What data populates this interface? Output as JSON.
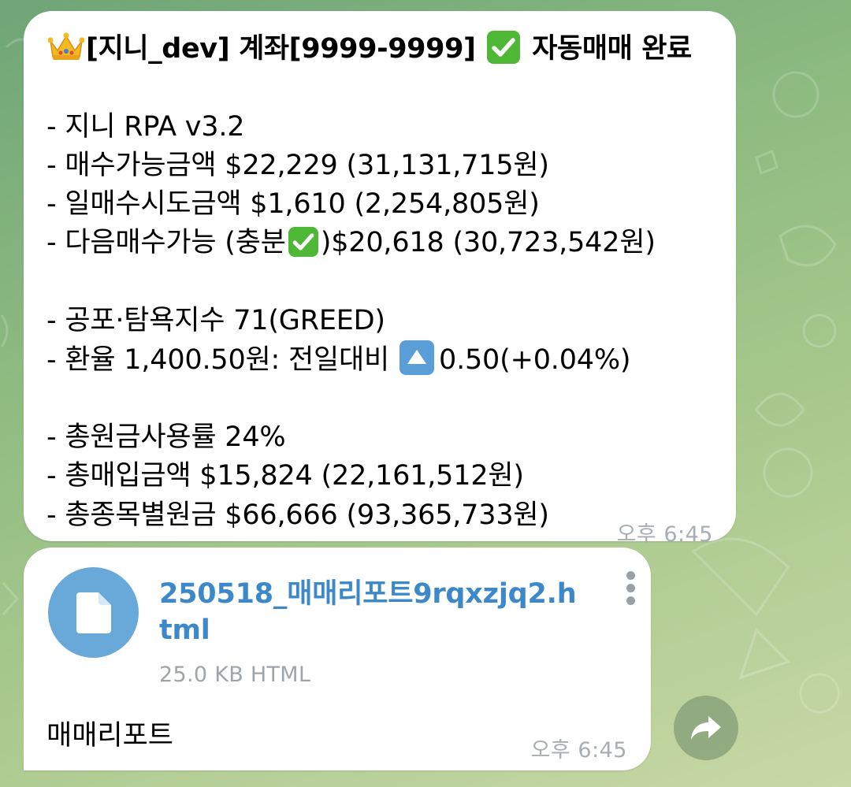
{
  "message": {
    "title_prefix": "[지니_dev] 계좌[9999-9999]",
    "title_suffix": "자동매매 완료",
    "line1": "- 지니 RPA v3.2",
    "line2": "- 매수가능금액 $22,229 (31,131,715원)",
    "line3": "- 일매수시도금액 $1,610 (2,254,805원)",
    "line4_prefix": "- 다음매수가능 (충분",
    "line4_suffix": ")$20,618 (30,723,542원)",
    "line5": "- 공포·탐욕지수 71(GREED)",
    "line6_prefix": "- 환율 1,400.50원: 전일대비",
    "line6_suffix": "0.50(+0.04%)",
    "line7": "- 총원금사용률 24%",
    "line8": "- 총매입금액 $15,824 (22,161,512원)",
    "line9": "- 총종목별원금 $66,666 (93,365,733원)",
    "time": "오후 6:45"
  },
  "attachment": {
    "file_name": "250518_매매리포트9rqxzjq2.html",
    "file_meta": "25.0 KB HTML",
    "caption": "매매리포트",
    "time": "오후 6:45"
  },
  "icons": {
    "crown": "crown-icon",
    "check": "check-mark-button-icon",
    "up": "up-arrow-button-icon",
    "file": "document-icon",
    "more": "more-vertical-icon",
    "share": "share-icon"
  },
  "colors": {
    "link": "#3d88c8",
    "file_icon_bg": "#68a9d9",
    "check_green": "#4eb736",
    "up_blue": "#5b9dd6"
  }
}
